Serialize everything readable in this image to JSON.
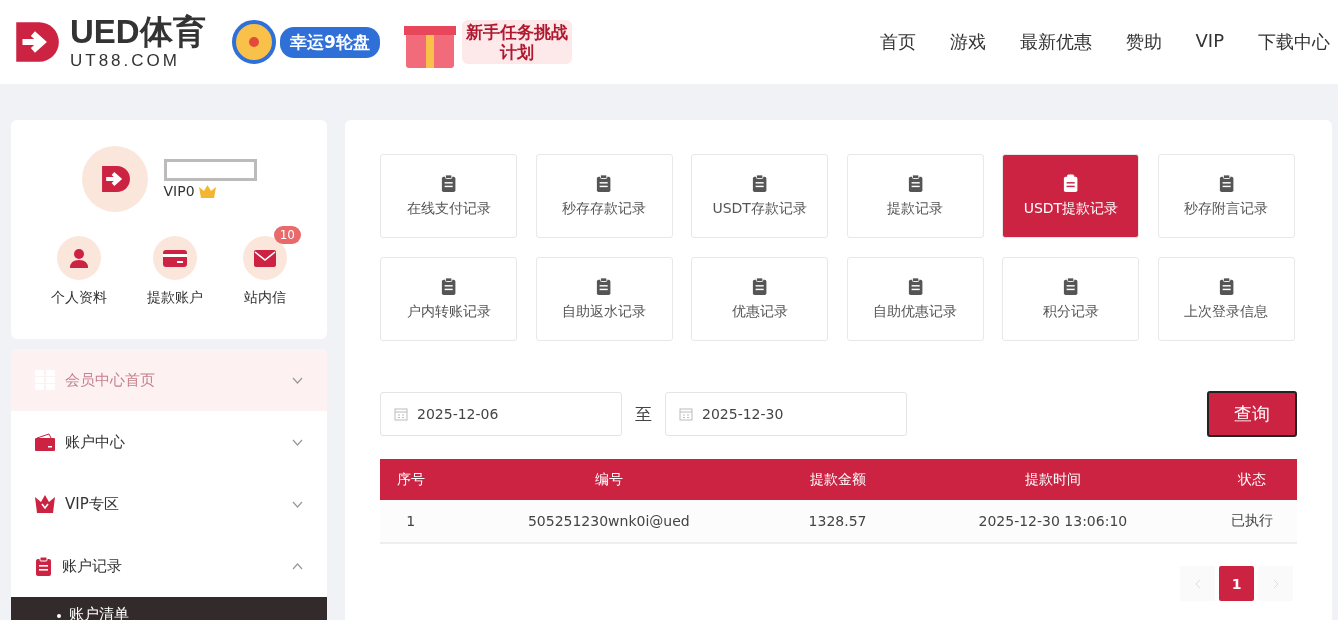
{
  "header": {
    "logo": {
      "title": "UED体育",
      "subtitle": "UT88.COM"
    },
    "banners": [
      {
        "kind": "wheel",
        "text": "幸运9轮盘"
      },
      {
        "kind": "gift",
        "text": "新手任务挑战计划"
      }
    ],
    "nav": [
      {
        "label": "首页"
      },
      {
        "label": "游戏"
      },
      {
        "label": "最新优惠"
      },
      {
        "label": "赞助"
      },
      {
        "label": "VIP"
      },
      {
        "label": "下载中心"
      }
    ]
  },
  "profile": {
    "vip": "VIP0",
    "shortcuts": [
      {
        "kind": "user",
        "label": "个人资料"
      },
      {
        "kind": "card",
        "label": "提款账户"
      },
      {
        "kind": "mail",
        "label": "站内信",
        "badge": "10"
      }
    ]
  },
  "sidebar": {
    "items": [
      {
        "kind": "grid",
        "label": "会员中心首页",
        "expanded": false,
        "faded": true
      },
      {
        "kind": "wallet",
        "label": "账户中心",
        "expanded": false,
        "faded": false
      },
      {
        "kind": "crown",
        "label": "VIP专区",
        "expanded": false,
        "faded": false
      },
      {
        "kind": "clipboard",
        "label": "账户记录",
        "expanded": true,
        "faded": false,
        "children": [
          {
            "label": "账户清单"
          }
        ]
      }
    ]
  },
  "record_tabs": [
    {
      "label": "在线支付记录",
      "selected": false
    },
    {
      "label": "秒存存款记录",
      "selected": false
    },
    {
      "label": "USDT存款记录",
      "selected": false
    },
    {
      "label": "提款记录",
      "selected": false
    },
    {
      "label": "USDT提款记录",
      "selected": true
    },
    {
      "label": "秒存附言记录",
      "selected": false
    },
    {
      "label": "户内转账记录",
      "selected": false
    },
    {
      "label": "自助返水记录",
      "selected": false
    },
    {
      "label": "优惠记录",
      "selected": false
    },
    {
      "label": "自助优惠记录",
      "selected": false
    },
    {
      "label": "积分记录",
      "selected": false
    },
    {
      "label": "上次登录信息",
      "selected": false
    }
  ],
  "filter": {
    "start": "2025-12-06",
    "separator": "至",
    "end": "2025-12-30",
    "button": "查询"
  },
  "table": {
    "columns": [
      "序号",
      "编号",
      "提款金额",
      "提款时间",
      "状态"
    ],
    "rows": [
      [
        "1",
        "505251230wnk0i@ued",
        "1328.57",
        "2025-12-30 13:06:10",
        "已执行"
      ]
    ]
  },
  "pagination": {
    "pages": [
      {
        "label": "1",
        "selected": true
      }
    ]
  }
}
